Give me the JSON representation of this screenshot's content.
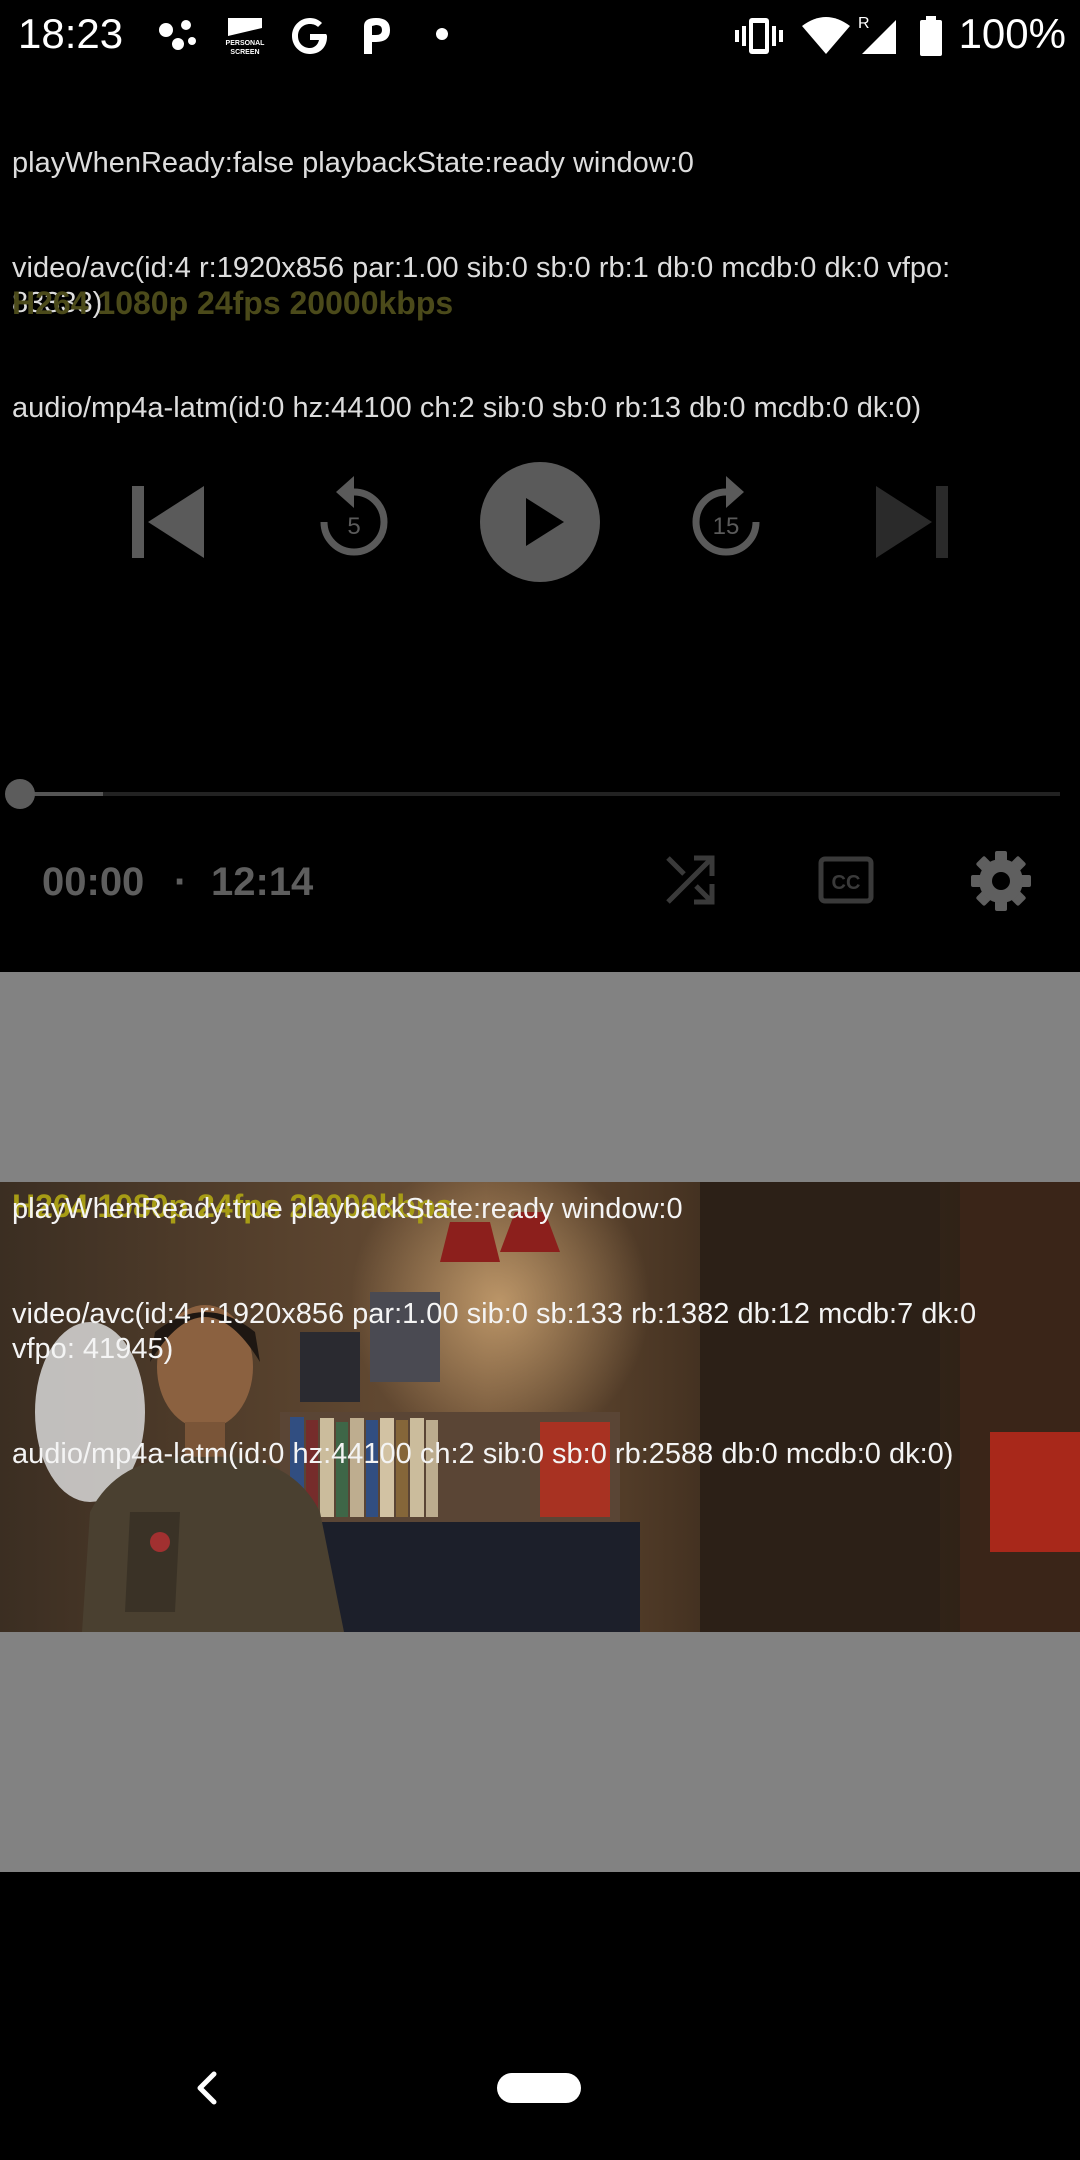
{
  "status_bar": {
    "time": "18:23",
    "battery": "100%",
    "left_icons": [
      "assistant-dots-icon",
      "personal-screen-icon",
      "google-icon",
      "p-app-icon",
      "dot-icon"
    ],
    "right_icons": [
      "vibrate-icon",
      "wifi-icon",
      "signal-roaming-icon",
      "battery-icon"
    ],
    "roaming_label": "R",
    "personal_screen_label": [
      "PERSONAL",
      "SCREEN"
    ]
  },
  "top_player": {
    "debug_lines": [
      "playWhenReady:false playbackState:ready window:0",
      "video/avc(id:4 r:1920x856 par:1.00 sib:0 sb:0 rb:1 db:0 mcdb:0 dk:0 vfpo:\n83333)",
      "audio/mp4a-latm(id:0 hz:44100 ch:2 sib:0 sb:0 rb:13 db:0 mcdb:0 dk:0)"
    ],
    "format_label": "H264 1080p 24fps  20000kbps",
    "controls": {
      "rewind_seconds": "5",
      "forward_seconds": "15"
    },
    "position": "00:00",
    "separator": "·",
    "duration": "12:14",
    "progress_fraction": 0.0,
    "buffered_fraction": 0.08,
    "bottom_icons": [
      "shuffle-icon",
      "closed-captions-icon",
      "settings-icon"
    ],
    "cc_label": "CC"
  },
  "bottom_player": {
    "debug_lines": [
      "playWhenReady:true playbackState:ready window:0",
      "video/avc(id:4 r:1920x856 par:1.00 sib:0 sb:133 rb:1382 db:12 mcdb:7 dk:0\nvfpo: 41945)",
      "audio/mp4a-latm(id:0 hz:44100 ch:2 sib:0 sb:0 rb:2588 db:0 mcdb:0 dk:0)"
    ],
    "format_label": "H264 1080p 24fps  20000kbps"
  },
  "colors": {
    "player_bg": "#000000",
    "second_player_bg": "#828282",
    "format_label_dim": "#4b4a1a",
    "format_label": "#a79c15"
  },
  "nav_bar": {
    "icons": [
      "back-icon",
      "home-pill"
    ]
  }
}
